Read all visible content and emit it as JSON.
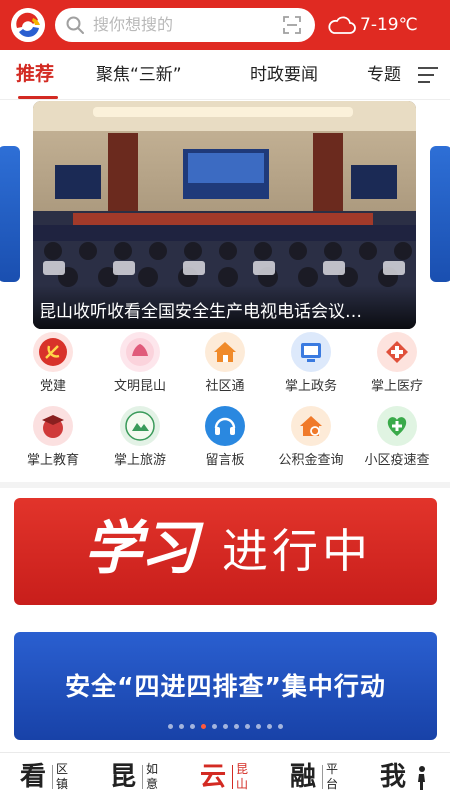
{
  "header": {
    "search_placeholder": "搜你想搜的",
    "weather_temp": "7-19℃",
    "weather_icon": "cloud-icon",
    "brand_color": "#e02a22"
  },
  "tabs": [
    {
      "label": "推荐",
      "active": true
    },
    {
      "label": "聚焦“三新”",
      "active": false
    },
    {
      "label": "时政要闻",
      "active": false
    },
    {
      "label": "专题",
      "active": false
    }
  ],
  "hero": {
    "caption": "昆山收听收看全国安全生产电视电话会议…"
  },
  "grid": [
    {
      "label": "党建",
      "icon": "party-emblem-icon",
      "color": "#d8322a"
    },
    {
      "label": "文明昆山",
      "icon": "civilization-icon",
      "color": "#e05a7a"
    },
    {
      "label": "社区通",
      "icon": "community-house-icon",
      "color": "#f08a2a"
    },
    {
      "label": "掌上政务",
      "icon": "government-icon",
      "color": "#3a7ae0"
    },
    {
      "label": "掌上医疗",
      "icon": "medical-icon",
      "color": "#e0503a"
    },
    {
      "label": "掌上教育",
      "icon": "education-cap-icon",
      "color": "#d03a3a"
    },
    {
      "label": "掌上旅游",
      "icon": "tourism-icon",
      "color": "#3a9a5a"
    },
    {
      "label": "留言板",
      "icon": "message-board-icon",
      "color": "#2a88e0"
    },
    {
      "label": "公积金查询",
      "icon": "housing-fund-icon",
      "color": "#f07a2a"
    },
    {
      "label": "小区疫速查",
      "icon": "epidemic-check-icon",
      "color": "#3aaa4a"
    }
  ],
  "banner1": {
    "script": "学习",
    "text": "进行中"
  },
  "banner2": {
    "text": "安全“四进四排查”集中行动",
    "dots": 11,
    "active_dot": 3
  },
  "bottom_nav": [
    {
      "big": "看",
      "small": "区镇",
      "active": false
    },
    {
      "big": "昆",
      "small": "如意",
      "active": false
    },
    {
      "big": "云",
      "small": "昆山",
      "active": true
    },
    {
      "big": "融",
      "small": "平台",
      "active": false
    },
    {
      "big": "我",
      "small": "",
      "active": false
    }
  ]
}
